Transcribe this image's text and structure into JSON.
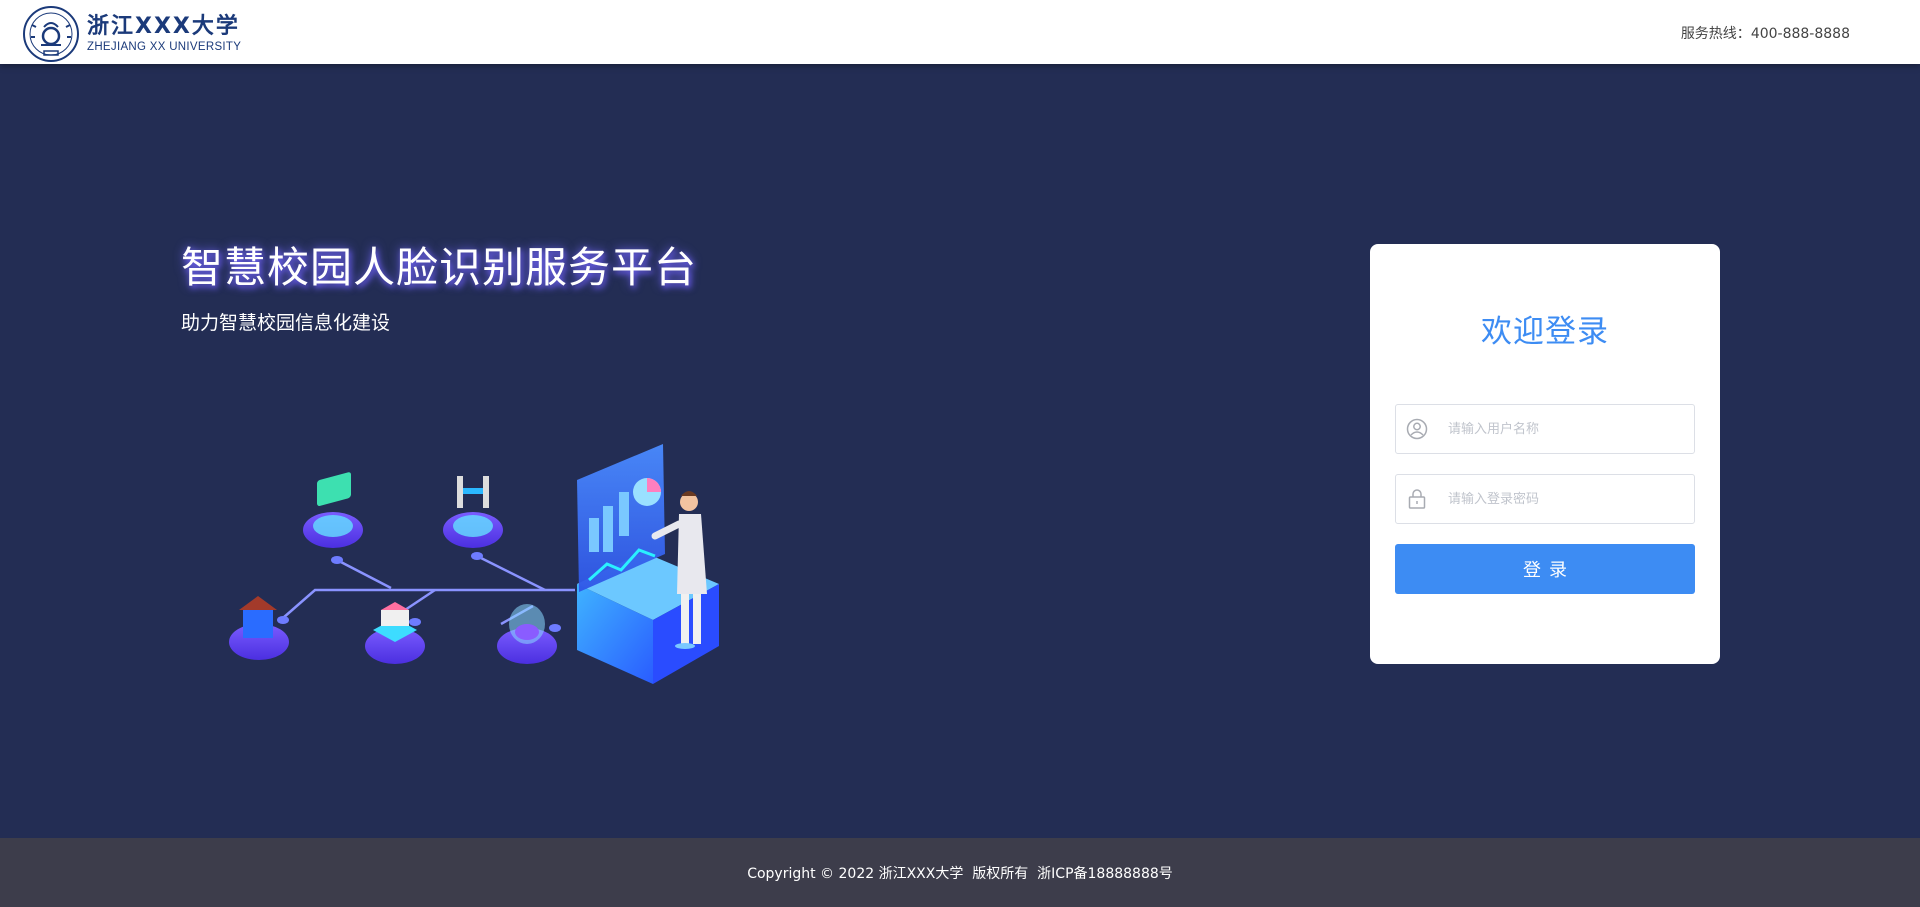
{
  "header": {
    "logo_cn": "浙江XXX大学",
    "logo_en": "ZHEJIANG XX UNIVERSITY",
    "hotline_label": "服务热线：",
    "hotline_number": "400-888-8888"
  },
  "hero": {
    "title": "智慧校园人脸识别服务平台",
    "subtitle": "助力智慧校园信息化建设"
  },
  "login": {
    "title": "欢迎登录",
    "username_placeholder": "请输入用户名称",
    "username_value": "",
    "password_placeholder": "请输入登录密码",
    "password_value": "",
    "button_label": "登录"
  },
  "footer": {
    "copyright": "Copyright © 2022 浙江XXX大学  版权所有  浙ICP备18888888号"
  },
  "colors": {
    "accent": "#3d8cf3",
    "main_bg": "#232d54",
    "footer_bg": "#3d3d4b",
    "brand": "#1b3a7a"
  },
  "icons": {
    "username": "user-circle-icon",
    "password": "lock-icon"
  }
}
